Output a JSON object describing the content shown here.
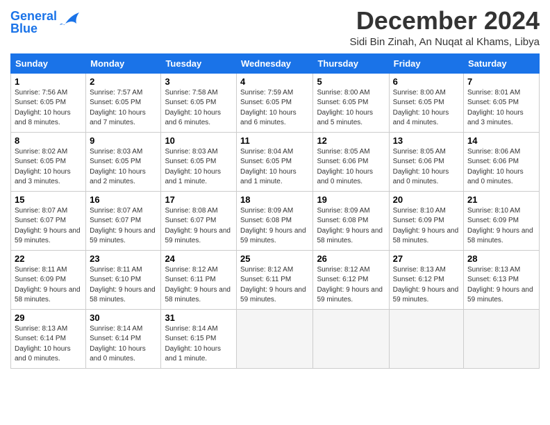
{
  "logo": {
    "general": "General",
    "blue": "Blue"
  },
  "header": {
    "month_year": "December 2024",
    "location": "Sidi Bin Zinah, An Nuqat al Khams, Libya"
  },
  "weekdays": [
    "Sunday",
    "Monday",
    "Tuesday",
    "Wednesday",
    "Thursday",
    "Friday",
    "Saturday"
  ],
  "weeks": [
    [
      {
        "day": "1",
        "sunrise": "Sunrise: 7:56 AM",
        "sunset": "Sunset: 6:05 PM",
        "daylight": "Daylight: 10 hours and 8 minutes."
      },
      {
        "day": "2",
        "sunrise": "Sunrise: 7:57 AM",
        "sunset": "Sunset: 6:05 PM",
        "daylight": "Daylight: 10 hours and 7 minutes."
      },
      {
        "day": "3",
        "sunrise": "Sunrise: 7:58 AM",
        "sunset": "Sunset: 6:05 PM",
        "daylight": "Daylight: 10 hours and 6 minutes."
      },
      {
        "day": "4",
        "sunrise": "Sunrise: 7:59 AM",
        "sunset": "Sunset: 6:05 PM",
        "daylight": "Daylight: 10 hours and 6 minutes."
      },
      {
        "day": "5",
        "sunrise": "Sunrise: 8:00 AM",
        "sunset": "Sunset: 6:05 PM",
        "daylight": "Daylight: 10 hours and 5 minutes."
      },
      {
        "day": "6",
        "sunrise": "Sunrise: 8:00 AM",
        "sunset": "Sunset: 6:05 PM",
        "daylight": "Daylight: 10 hours and 4 minutes."
      },
      {
        "day": "7",
        "sunrise": "Sunrise: 8:01 AM",
        "sunset": "Sunset: 6:05 PM",
        "daylight": "Daylight: 10 hours and 3 minutes."
      }
    ],
    [
      {
        "day": "8",
        "sunrise": "Sunrise: 8:02 AM",
        "sunset": "Sunset: 6:05 PM",
        "daylight": "Daylight: 10 hours and 3 minutes."
      },
      {
        "day": "9",
        "sunrise": "Sunrise: 8:03 AM",
        "sunset": "Sunset: 6:05 PM",
        "daylight": "Daylight: 10 hours and 2 minutes."
      },
      {
        "day": "10",
        "sunrise": "Sunrise: 8:03 AM",
        "sunset": "Sunset: 6:05 PM",
        "daylight": "Daylight: 10 hours and 1 minute."
      },
      {
        "day": "11",
        "sunrise": "Sunrise: 8:04 AM",
        "sunset": "Sunset: 6:05 PM",
        "daylight": "Daylight: 10 hours and 1 minute."
      },
      {
        "day": "12",
        "sunrise": "Sunrise: 8:05 AM",
        "sunset": "Sunset: 6:06 PM",
        "daylight": "Daylight: 10 hours and 0 minutes."
      },
      {
        "day": "13",
        "sunrise": "Sunrise: 8:05 AM",
        "sunset": "Sunset: 6:06 PM",
        "daylight": "Daylight: 10 hours and 0 minutes."
      },
      {
        "day": "14",
        "sunrise": "Sunrise: 8:06 AM",
        "sunset": "Sunset: 6:06 PM",
        "daylight": "Daylight: 10 hours and 0 minutes."
      }
    ],
    [
      {
        "day": "15",
        "sunrise": "Sunrise: 8:07 AM",
        "sunset": "Sunset: 6:07 PM",
        "daylight": "Daylight: 9 hours and 59 minutes."
      },
      {
        "day": "16",
        "sunrise": "Sunrise: 8:07 AM",
        "sunset": "Sunset: 6:07 PM",
        "daylight": "Daylight: 9 hours and 59 minutes."
      },
      {
        "day": "17",
        "sunrise": "Sunrise: 8:08 AM",
        "sunset": "Sunset: 6:07 PM",
        "daylight": "Daylight: 9 hours and 59 minutes."
      },
      {
        "day": "18",
        "sunrise": "Sunrise: 8:09 AM",
        "sunset": "Sunset: 6:08 PM",
        "daylight": "Daylight: 9 hours and 59 minutes."
      },
      {
        "day": "19",
        "sunrise": "Sunrise: 8:09 AM",
        "sunset": "Sunset: 6:08 PM",
        "daylight": "Daylight: 9 hours and 58 minutes."
      },
      {
        "day": "20",
        "sunrise": "Sunrise: 8:10 AM",
        "sunset": "Sunset: 6:09 PM",
        "daylight": "Daylight: 9 hours and 58 minutes."
      },
      {
        "day": "21",
        "sunrise": "Sunrise: 8:10 AM",
        "sunset": "Sunset: 6:09 PM",
        "daylight": "Daylight: 9 hours and 58 minutes."
      }
    ],
    [
      {
        "day": "22",
        "sunrise": "Sunrise: 8:11 AM",
        "sunset": "Sunset: 6:09 PM",
        "daylight": "Daylight: 9 hours and 58 minutes."
      },
      {
        "day": "23",
        "sunrise": "Sunrise: 8:11 AM",
        "sunset": "Sunset: 6:10 PM",
        "daylight": "Daylight: 9 hours and 58 minutes."
      },
      {
        "day": "24",
        "sunrise": "Sunrise: 8:12 AM",
        "sunset": "Sunset: 6:11 PM",
        "daylight": "Daylight: 9 hours and 58 minutes."
      },
      {
        "day": "25",
        "sunrise": "Sunrise: 8:12 AM",
        "sunset": "Sunset: 6:11 PM",
        "daylight": "Daylight: 9 hours and 59 minutes."
      },
      {
        "day": "26",
        "sunrise": "Sunrise: 8:12 AM",
        "sunset": "Sunset: 6:12 PM",
        "daylight": "Daylight: 9 hours and 59 minutes."
      },
      {
        "day": "27",
        "sunrise": "Sunrise: 8:13 AM",
        "sunset": "Sunset: 6:12 PM",
        "daylight": "Daylight: 9 hours and 59 minutes."
      },
      {
        "day": "28",
        "sunrise": "Sunrise: 8:13 AM",
        "sunset": "Sunset: 6:13 PM",
        "daylight": "Daylight: 9 hours and 59 minutes."
      }
    ],
    [
      {
        "day": "29",
        "sunrise": "Sunrise: 8:13 AM",
        "sunset": "Sunset: 6:14 PM",
        "daylight": "Daylight: 10 hours and 0 minutes."
      },
      {
        "day": "30",
        "sunrise": "Sunrise: 8:14 AM",
        "sunset": "Sunset: 6:14 PM",
        "daylight": "Daylight: 10 hours and 0 minutes."
      },
      {
        "day": "31",
        "sunrise": "Sunrise: 8:14 AM",
        "sunset": "Sunset: 6:15 PM",
        "daylight": "Daylight: 10 hours and 1 minute."
      },
      null,
      null,
      null,
      null
    ]
  ]
}
